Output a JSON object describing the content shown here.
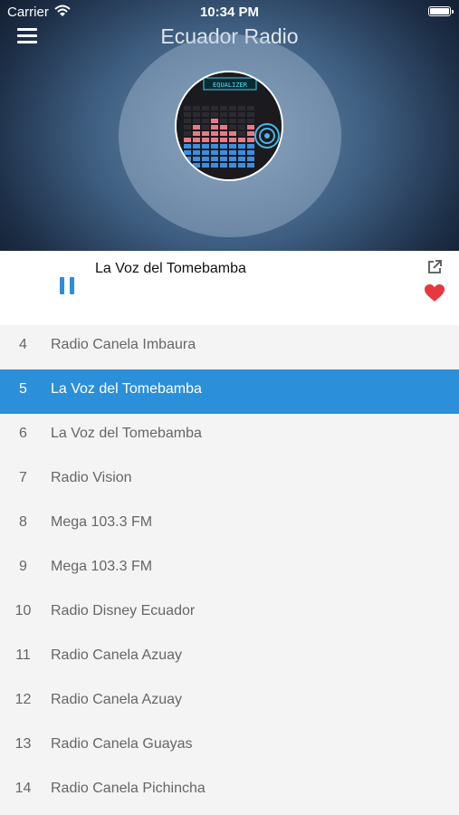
{
  "status_bar": {
    "carrier": "Carrier",
    "time": "10:34 PM"
  },
  "header": {
    "title": "Ecuador Radio"
  },
  "player": {
    "now_playing": "La Voz del Tomebamba"
  },
  "artwork": {
    "label": "EQUALIZER"
  },
  "stations": [
    {
      "num": "4",
      "name": "Radio Canela Imbaura"
    },
    {
      "num": "5",
      "name": "La Voz del Tomebamba",
      "active": true
    },
    {
      "num": "6",
      "name": "La Voz del Tomebamba"
    },
    {
      "num": "7",
      "name": "Radio Vision"
    },
    {
      "num": "8",
      "name": "Mega 103.3 FM"
    },
    {
      "num": "9",
      "name": "Mega 103.3 FM"
    },
    {
      "num": "10",
      "name": "Radio Disney Ecuador"
    },
    {
      "num": "11",
      "name": "Radio Canela Azuay"
    },
    {
      "num": "12",
      "name": "Radio Canela Azuay"
    },
    {
      "num": "13",
      "name": "Radio Canela Guayas"
    },
    {
      "num": "14",
      "name": "Radio Canela Pichincha"
    }
  ],
  "colors": {
    "accent": "#2b8fd9",
    "favorite": "#e8383f"
  }
}
